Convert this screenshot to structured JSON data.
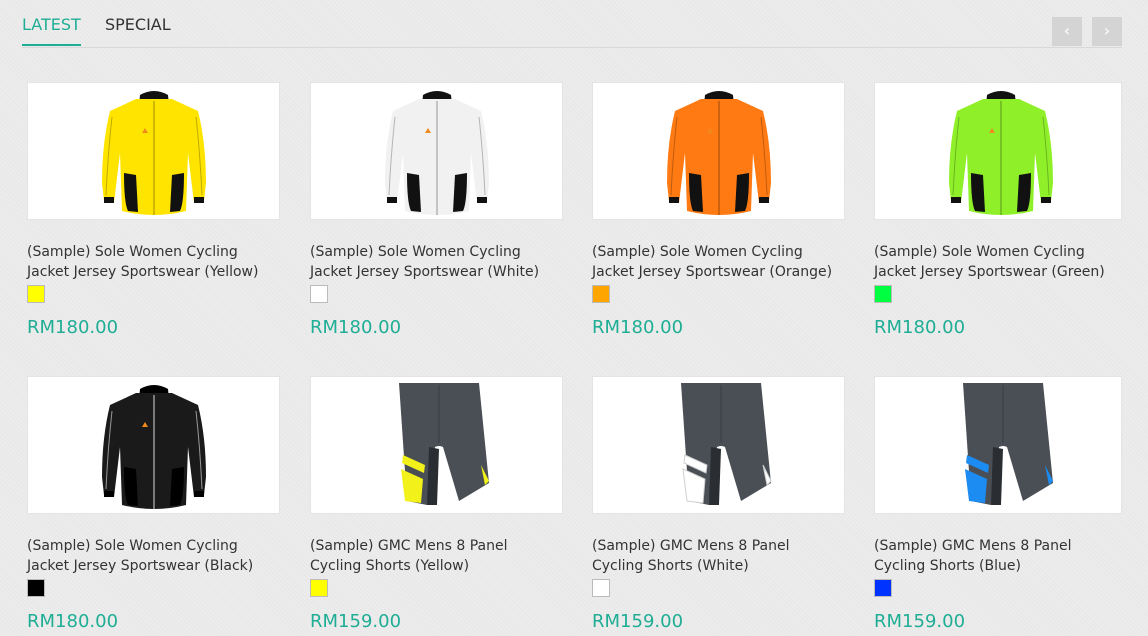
{
  "tabs": {
    "latest": "LATEST",
    "special": "SPECIAL"
  },
  "nav": {
    "prev": "‹",
    "next": "›"
  },
  "products": [
    {
      "title": "(Sample) Sole Women Cycling Jacket Jersey Sportswear (Yellow)",
      "price": "RM180.00",
      "swatch": "#ffff00",
      "image": "jacket",
      "color": "#ffe400"
    },
    {
      "title": "(Sample) Sole Women Cycling Jacket Jersey Sportswear (White)",
      "price": "RM180.00",
      "swatch": "#ffffff",
      "image": "jacket",
      "color": "#f1f1f1"
    },
    {
      "title": "(Sample) Sole Women Cycling Jacket Jersey Sportswear (Orange)",
      "price": "RM180.00",
      "swatch": "#ffa500",
      "image": "jacket",
      "color": "#ff7a12"
    },
    {
      "title": "(Sample) Sole Women Cycling Jacket Jersey Sportswear (Green)",
      "price": "RM180.00",
      "swatch": "#00ff40",
      "image": "jacket",
      "color": "#8ff02a"
    },
    {
      "title": "(Sample) Sole Women Cycling Jacket Jersey Sportswear (Black)",
      "price": "RM180.00",
      "swatch": "#000000",
      "image": "jacket",
      "color": "#1a1a1a"
    },
    {
      "title": "(Sample) GMC Mens 8 Panel Cycling Shorts (Yellow)",
      "price": "RM159.00",
      "swatch": "#ffff00",
      "image": "shorts",
      "color": "#f2f21a"
    },
    {
      "title": "(Sample) GMC Mens 8 Panel Cycling Shorts (White)",
      "price": "RM159.00",
      "swatch": "#ffffff",
      "image": "shorts",
      "color": "#ffffff"
    },
    {
      "title": "(Sample) GMC Mens 8 Panel Cycling Shorts (Blue)",
      "price": "RM159.00",
      "swatch": "#0033ff",
      "image": "shorts",
      "color": "#1c8cf2"
    }
  ]
}
